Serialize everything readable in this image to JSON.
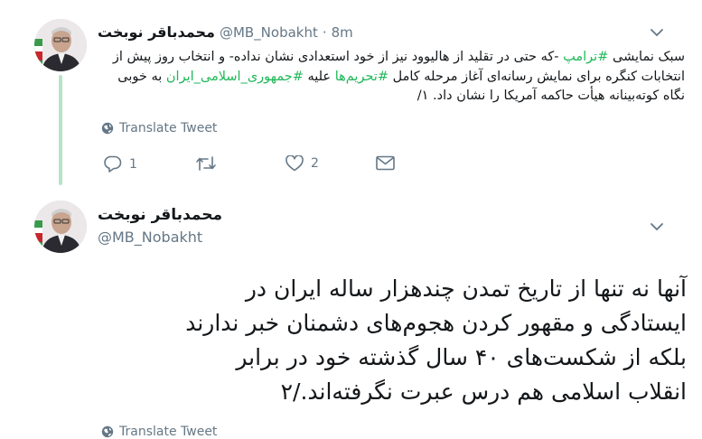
{
  "tweet1": {
    "display_name": "محمدباقر نوبخت",
    "handle": "@MB_Nobakht",
    "separator": "·",
    "time": "8m",
    "text_parts": [
      "سبک نمایشی ",
      "#ترامپ",
      " -که حتی در تقلید از هالیوود نیز از خود استعدادی نشان نداده- و انتخاب روز پیش از انتخابات کنگره برای نمایش رسانه‌ای آغاز مرحله کامل ",
      "#تحریم‌ها",
      " علیه ",
      "#جمهوری_اسلامی_ایران",
      " به خوبی نگاه کوته‌بینانه هیأت حاکمه آمریکا را نشان داد. ١/"
    ],
    "translate_label": "Translate Tweet",
    "reply_count": "1",
    "retweet_count": "",
    "like_count": "2"
  },
  "tweet2": {
    "display_name": "محمدباقر نوبخت",
    "handle": "@MB_Nobakht",
    "lines": [
      "آنها نه تنها از تاریخ تمدن چندهزار ساله ایران در",
      "ایستادگی و مقهور کردن هجوم‌های دشمنان خبر ندارند",
      "بلکه از شکست‌های ۴۰ سال گذشته خود در برابر",
      "انقلاب اسلامی هم درس عبرت نگرفته‌اند./۲"
    ],
    "translate_label": "Translate Tweet"
  },
  "icons": [
    "chevron-down-icon",
    "globe-icon",
    "reply-icon",
    "retweet-icon",
    "like-icon",
    "message-icon"
  ],
  "colors": {
    "hashtag": "#1fb859",
    "thread_line": "#b7e3c9",
    "muted": "#657786"
  }
}
